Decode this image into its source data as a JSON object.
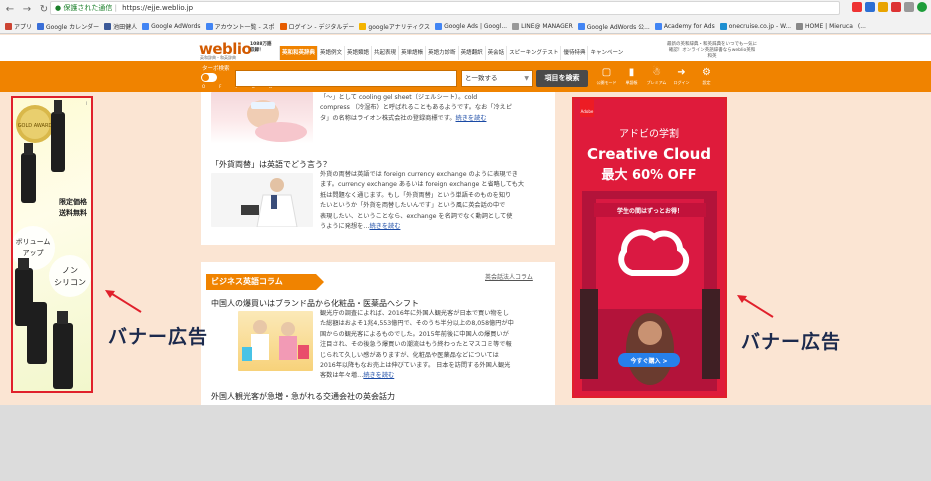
{
  "browser": {
    "secure_label": "保護された通信",
    "url": "https://ejje.weblio.jp",
    "bookmarks": [
      "アプリ",
      "Google カレンダー",
      "池田健人",
      "Google AdWords",
      "アカウント一覧 - スポ",
      "ログイン - デジタルデー",
      "googleアナリティクス",
      "Google Ads | Googl...",
      "LINE@ MANAGER",
      "Google AdWords 公...",
      "Academy for Ads",
      "onecruise.co.jp - W...",
      "HOME | Mieruca",
      "(..."
    ]
  },
  "header": {
    "logo": "weblio",
    "logo_sub": "英和辞典・和英辞典",
    "count_badge": "1088万語収録！",
    "nav_tabs": [
      "英和和英辞典",
      "英語例文",
      "英語類語",
      "共起表現",
      "英単語帳",
      "英語力診断",
      "英語翻訳",
      "英会話",
      "スピーキングテスト",
      "優待特典",
      "キャンペーン"
    ],
    "promo": "最新の英和辞典・和英辞典をいつでも一気に確認！オンライン英語辞書ならweblio英和和英"
  },
  "search": {
    "turbo_label": "ターボ検索",
    "off": "OFF",
    "on": "ON",
    "match_value": "と一致する",
    "button": "項目を検索",
    "tools": [
      {
        "icon": "sun-mode",
        "label": "公開モード"
      },
      {
        "icon": "vocab-book",
        "label": "単語帳"
      },
      {
        "icon": "premium",
        "label": "プレミアム"
      },
      {
        "icon": "login",
        "label": "ログイン"
      },
      {
        "icon": "settings",
        "label": "設定"
      }
    ]
  },
  "articles": [
    {
      "title": "",
      "snippet_lines": [
        "「〜」として cooling gel sheet（ジェルシート）。cold",
        "compress （冷湿布）と呼ばれることもあるようです。なお「冷えピ",
        "タ」の名称はライオン株式会社の登録商標です。"
      ],
      "more": "続きを読む"
    },
    {
      "title": "「外貨両替」は英語でどう言う？",
      "snippet_lines": [
        "外貨の両替は英語では foreign currency exchange のように表現でき",
        "ます。currency exchange あるいは foreign exchange と省略しても大",
        "抵は問題なく通じます。もし「外貨両替」という単語そのものを知り",
        "たいというか「外貨を両替したいんです」という風に英会話の中で",
        "表現したい、ということなら、exchange を名詞でなく動詞として使",
        "うように発想を…"
      ],
      "more": "続きを読む"
    }
  ],
  "business_column": {
    "section_title": "ビジネス英語コラム",
    "section_link": "英会話法人コラム",
    "article_title": "中国人の爆買いはブランド品から化粧品・医薬品へシフト",
    "snippet_lines": [
      "観光庁の調査によれば、2016年に外国人観光客が日本で買い物をし",
      "た総額はおよそ1兆4,553億円で、そのうち半分以上の8,058億円が中",
      "国からの観光客によるものでした。2015年前後に中国人の爆買いが",
      "注目され、その後急う爆買いの潮流はもう終わったとマスコミ等で報",
      "じられて久しい感がありますが、化粧品や医薬品などについては",
      "2016年以降もなお売上は伸びています。 日本を訪問する外国人観光",
      "客数は年々増…"
    ],
    "more": "続きを読む",
    "next_title": "外国人観光客が急増・急がれる交通会社の英会話力"
  },
  "ad_left": {
    "badge_text": "GOLD AWARD",
    "price_line1": "限定価格",
    "price_line2": "送料無料",
    "volume": "ボリューム\nアップ",
    "silicone": "ノン\nシリコン",
    "info_icon": "i"
  },
  "ad_right": {
    "brand": "Adobe",
    "headline1": "アドビの学割",
    "headline2": "Creative Cloud",
    "headline3": "最大 60% OFF",
    "ribbon": "学生の間はずっとお得！",
    "cta": "今すぐ購入 >"
  },
  "captions": {
    "left": "バナー広告",
    "right": "バナー広告"
  }
}
